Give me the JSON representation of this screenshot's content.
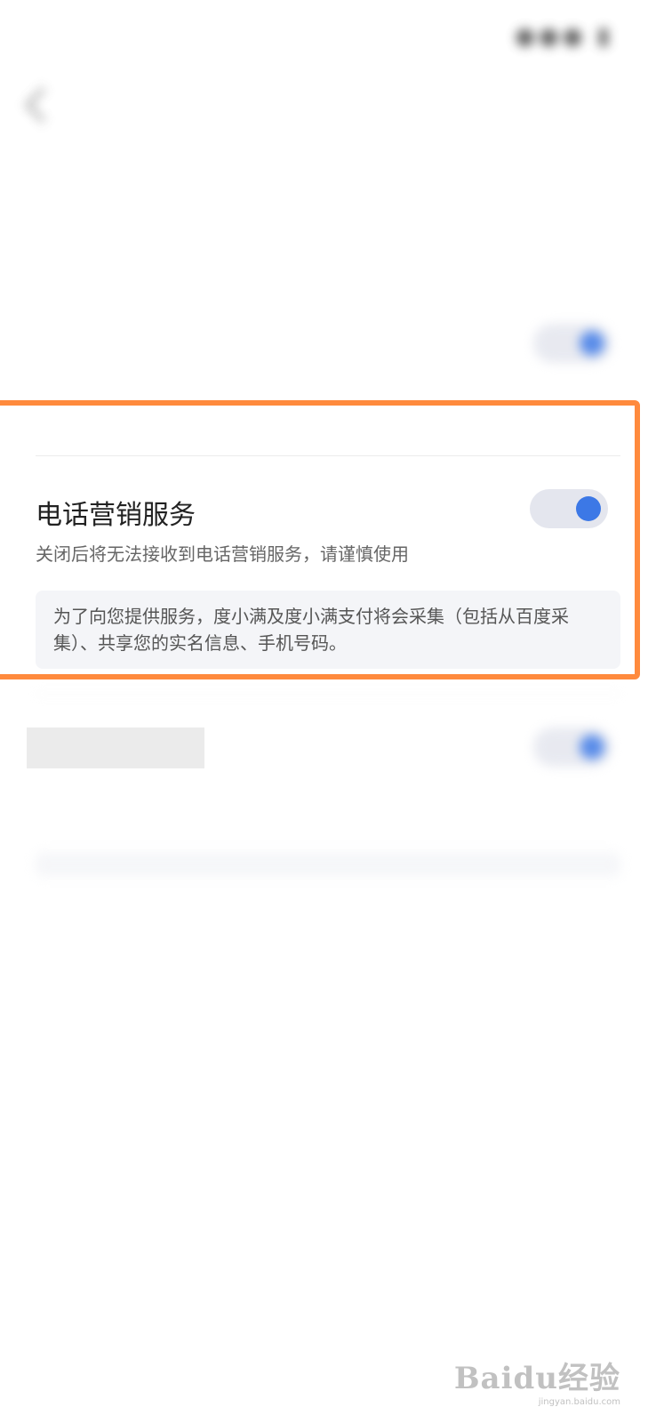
{
  "status_bar": {
    "time": "",
    "icons": "●●● ▮"
  },
  "header": {
    "title": ""
  },
  "sections": [
    {
      "title": "",
      "desc": "",
      "toggle_on": true
    },
    {
      "title": "电话营销服务",
      "desc": "关闭后将无法接收到电话营销服务，请谨慎使用",
      "note": "为了向您提供服务，度小满及度小满支付将会采集（包括从百度采集）、共享您的实名信息、手机号码。",
      "toggle_on": true
    },
    {
      "title": "",
      "desc": "",
      "note": "",
      "toggle_on": true
    }
  ],
  "colors": {
    "toggle_track": "#e4e6ee",
    "toggle_knob": "#3c78e6",
    "highlight_border": "#ff8a3d"
  },
  "watermark": {
    "logo": "Baidu经验",
    "url": "jingyan.baidu.com"
  }
}
